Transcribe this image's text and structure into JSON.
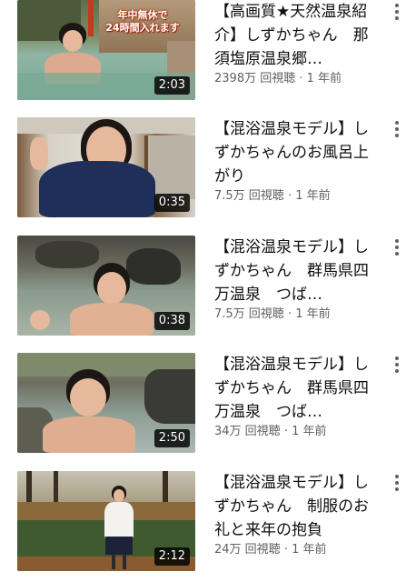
{
  "colors": {
    "title_text": "#0f0f0f",
    "meta_text": "#606060",
    "duration_bg": "#000000",
    "duration_text": "#ffffff",
    "background": "#ffffff"
  },
  "videos": [
    {
      "title": "【高画質★天然温泉紹介】しずかちゃん　那須塩原温泉郷…",
      "views": "2398万 回視聴",
      "separator": "·",
      "age": "1 年前",
      "duration": "2:03",
      "thumbnail_overlay": [
        "年中無休で",
        "24時間入れます"
      ],
      "menu_icon": "more-vertical-icon"
    },
    {
      "title": "【混浴温泉モデル】しずかちゃんのお風呂上がり",
      "views": "7.5万 回視聴",
      "separator": "·",
      "age": "1 年前",
      "duration": "0:35",
      "menu_icon": "more-vertical-icon"
    },
    {
      "title": "【混浴温泉モデル】しずかちゃん　群馬県四万温泉　つば…",
      "views": "7.5万 回視聴",
      "separator": "·",
      "age": "1 年前",
      "duration": "0:38",
      "menu_icon": "more-vertical-icon"
    },
    {
      "title": "【混浴温泉モデル】しずかちゃん　群馬県四万温泉　つば…",
      "views": "34万 回視聴",
      "separator": "·",
      "age": "1 年前",
      "duration": "2:50",
      "menu_icon": "more-vertical-icon"
    },
    {
      "title": "【混浴温泉モデル】しずかちゃん　制服のお礼と来年の抱負",
      "views": "24万 回視聴",
      "separator": "·",
      "age": "1 年前",
      "duration": "2:12",
      "menu_icon": "more-vertical-icon"
    }
  ]
}
